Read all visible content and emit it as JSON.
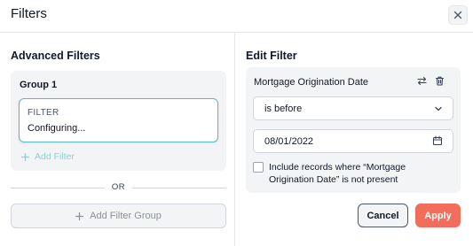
{
  "dialog": {
    "title": "Filters"
  },
  "advanced": {
    "title": "Advanced Filters",
    "group": {
      "label": "Group 1",
      "filter": {
        "label": "FILTER",
        "status": "Configuring..."
      },
      "add_filter_label": "Add Filter"
    },
    "or_label": "OR",
    "add_group_label": "Add Filter Group"
  },
  "edit": {
    "title": "Edit Filter",
    "field_name": "Mortgage Origination Date",
    "operator": "is before",
    "date_value": "08/01/2022",
    "checkbox_label": "Include records where “Mortgage Origination Date” is not present",
    "checkbox_checked": false
  },
  "actions": {
    "cancel_label": "Cancel",
    "apply_label": "Apply"
  },
  "colors": {
    "accent_teal": "#5fb8bd",
    "apply": "#f26d5b"
  },
  "icons": [
    "close-icon",
    "plus-icon",
    "swap-icon",
    "trash-icon",
    "chevron-down-icon",
    "calendar-icon"
  ]
}
